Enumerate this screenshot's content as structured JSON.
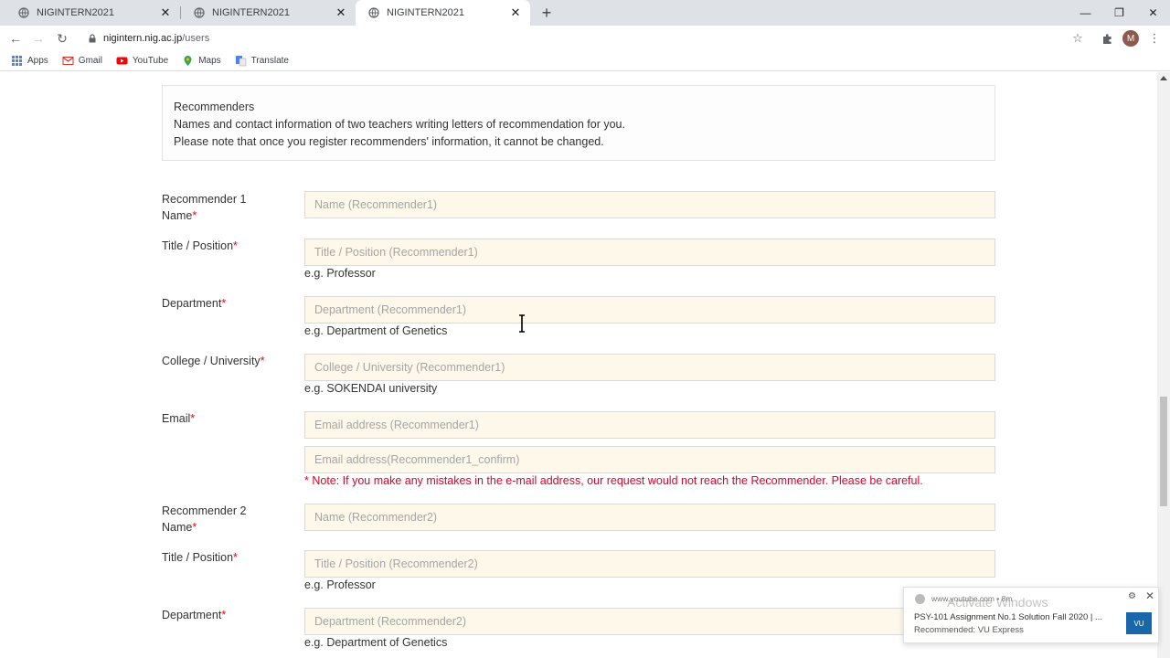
{
  "browser": {
    "tabs": [
      {
        "title": "NIGINTERN2021"
      },
      {
        "title": "NIGINTERN2021"
      },
      {
        "title": "NIGINTERN2021"
      }
    ],
    "url_domain": "nigintern.nig.ac.jp",
    "url_path": "/users",
    "avatar_letter": "M",
    "bookmarks": [
      "Apps",
      "Gmail",
      "YouTube",
      "Maps",
      "Translate"
    ]
  },
  "intro": {
    "title": "Recommenders",
    "line1": "Names and contact information of two teachers writing letters of recommendation for you.",
    "line2": "Please note that once you register recommenders' information, it cannot be changed."
  },
  "required_mark": "*",
  "form": {
    "r1_name_label": "Recommender 1 Name",
    "r1_name_placeholder": "Name (Recommender1)",
    "r1_title_label": "Title / Position",
    "r1_title_placeholder": "Title / Position (Recommender1)",
    "r1_title_hint": "e.g. Professor",
    "r1_dept_label": "Department",
    "r1_dept_placeholder": "Department (Recommender1)",
    "r1_dept_hint": "e.g. Department of Genetics",
    "r1_college_label": "College / University",
    "r1_college_placeholder": "College / University (Recommender1)",
    "r1_college_hint": "e.g. SOKENDAI university",
    "r1_email_label": "Email",
    "r1_email_placeholder": "Email address (Recommender1)",
    "r1_email_confirm_placeholder": "Email address(Recommender1_confirm)",
    "r1_email_note": "* Note: If you make any mistakes in the e-mail address, our request would not reach the Recommender. Please be careful.",
    "r2_name_label": "Recommender 2 Name",
    "r2_name_placeholder": "Name (Recommender2)",
    "r2_title_label": "Title / Position",
    "r2_title_placeholder": "Title / Position (Recommender2)",
    "r2_title_hint": "e.g. Professor",
    "r2_dept_label": "Department",
    "r2_dept_placeholder": "Department (Recommender2)",
    "r2_dept_hint": "e.g. Department of Genetics"
  },
  "notification": {
    "site": "www.youtube.com",
    "age": "8m",
    "title": "PSY-101 Assignment No.1 Solution Fall 2020 | ...",
    "subtitle": "Recommended: VU Express"
  },
  "watermark": "Activate Windows"
}
